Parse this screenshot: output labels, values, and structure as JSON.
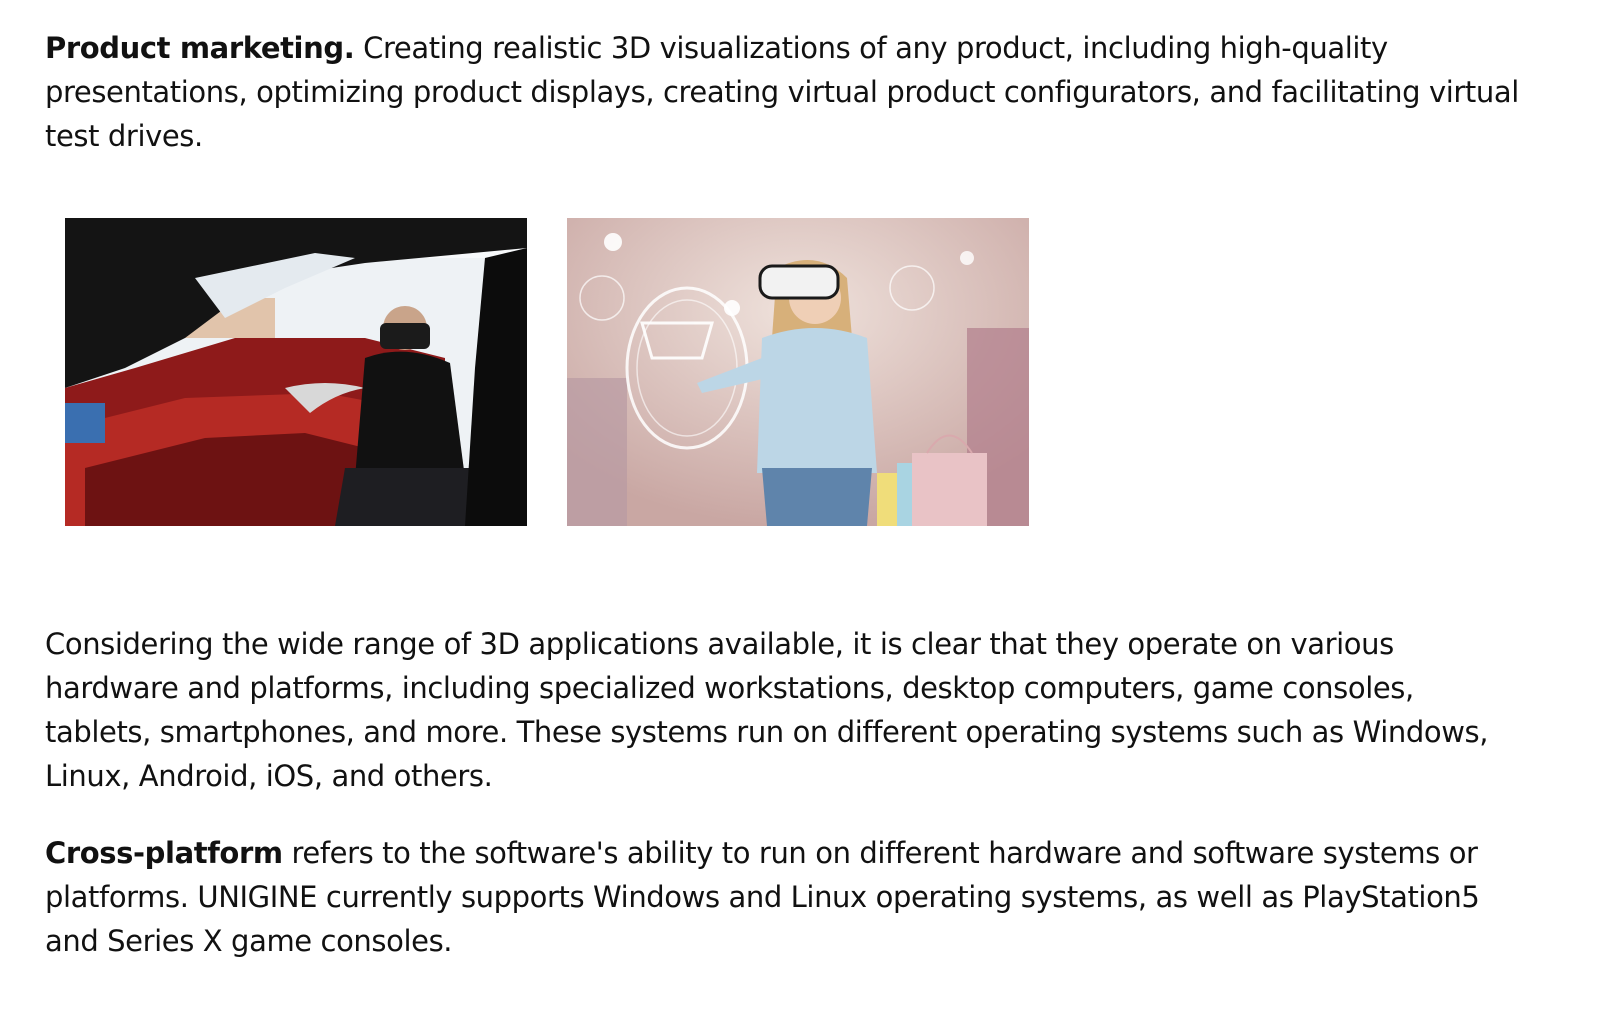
{
  "sections": {
    "product_marketing": {
      "heading": "Product marketing.",
      "text": " Creating realistic 3D visualizations of any product, including high-quality presentations, optimizing product displays, creating virtual product configurators, and facilitating virtual test drives."
    },
    "platforms": {
      "text": "Considering the wide range of 3D applications available, it is clear that they operate on various hardware and platforms, including specialized workstations, desktop computers, game consoles, tablets, smartphones, and more. These systems run on different operating systems such as Windows, Linux, Android, iOS, and others."
    },
    "cross_platform": {
      "heading": "Cross-platform",
      "text": " refers to the software's ability to run on different hardware and software systems or platforms. UNIGINE currently supports Windows and Linux operating systems, as well as PlayStation5 and Series X game consoles."
    }
  },
  "images": {
    "car_vr": {
      "icon": "vr-headset-car-photo"
    },
    "shop_vr": {
      "icon": "vr-headset-shopping-photo"
    }
  }
}
